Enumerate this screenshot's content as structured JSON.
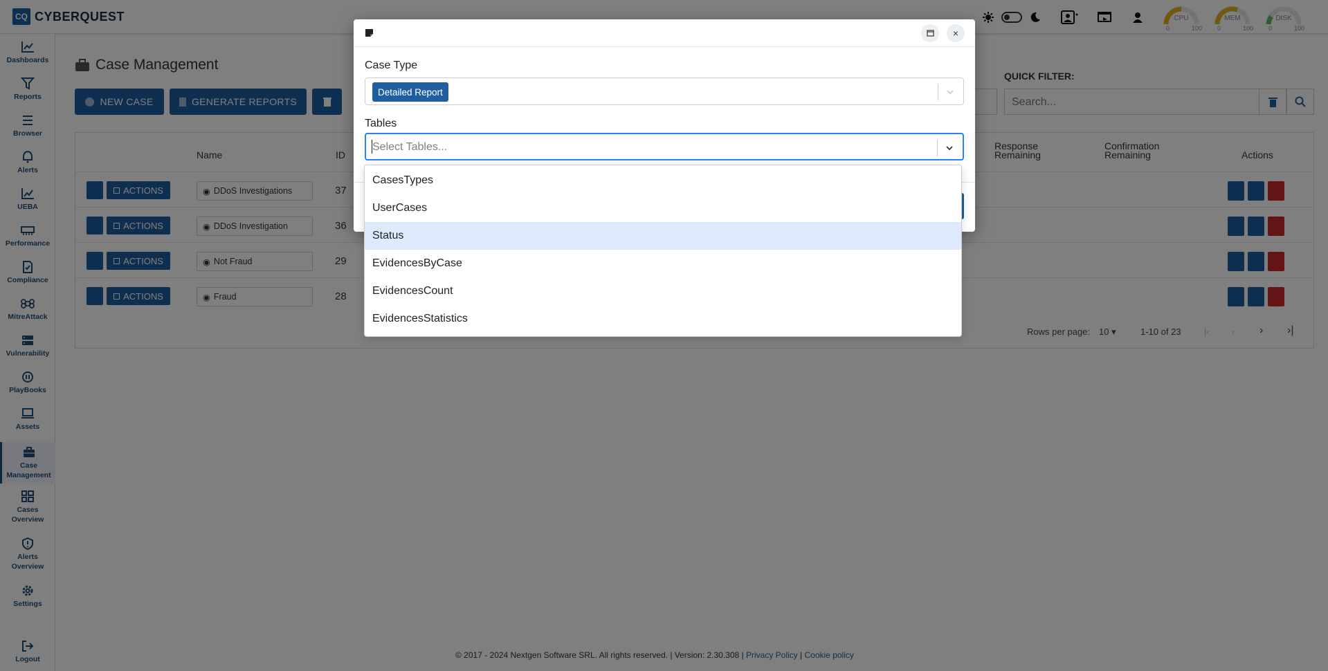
{
  "app": {
    "logo_mark": "CQ",
    "logo_text": "CYBERQUEST"
  },
  "gauges": [
    {
      "label": "CPU",
      "min": "0",
      "max": "100"
    },
    {
      "label": "MEM",
      "min": "0",
      "max": "100"
    },
    {
      "label": "DISK",
      "min": "0",
      "max": "100"
    }
  ],
  "sidebar": {
    "items": [
      {
        "label": "Dashboards",
        "icon": "chart-line-icon"
      },
      {
        "label": "Reports",
        "icon": "filter-icon"
      },
      {
        "label": "Browser",
        "icon": "list-icon"
      },
      {
        "label": "Alerts",
        "icon": "bell-icon"
      },
      {
        "label": "UEBA",
        "icon": "chart-icon"
      },
      {
        "label": "Performance",
        "icon": "memory-icon"
      },
      {
        "label": "Compliance",
        "icon": "document-check-icon"
      },
      {
        "label": "MitreAttack",
        "icon": "command-icon"
      },
      {
        "label": "Vulnerability",
        "icon": "server-icon"
      },
      {
        "label": "PlayBooks",
        "icon": "playbook-icon"
      },
      {
        "label": "Assets",
        "icon": "laptop-icon"
      },
      {
        "label": "Case",
        "label2": "Management",
        "icon": "briefcase-icon"
      },
      {
        "label": "Cases",
        "label2": "Overview",
        "icon": "grid-icon"
      },
      {
        "label": "Alerts",
        "label2": "Overview",
        "icon": "shield-alert-icon"
      },
      {
        "label": "Settings",
        "icon": "gear-icon"
      },
      {
        "label": "Logout",
        "icon": "logout-icon"
      }
    ]
  },
  "page": {
    "title": "Case Management",
    "new_case_label": "NEW CASE",
    "generate_reports_label": "GENERATE REPORTS",
    "quick_filter_label": "QUICK FILTER:",
    "quick_filter_placeholder": "Search..."
  },
  "table": {
    "columns": {
      "name": "Name",
      "id": "ID",
      "response_1": "Response",
      "response_2": "Remaining",
      "confirmation_1": "Confirmation",
      "confirmation_2": "Remaining",
      "actions": "Actions"
    },
    "action_label": "ACTIONS",
    "rows": [
      {
        "name": "DDoS Investigations",
        "id": "37"
      },
      {
        "name": "DDoS Investigation",
        "id": "36"
      },
      {
        "name": "Not Fraud",
        "id": "29"
      },
      {
        "name": "Fraud",
        "id": "28"
      }
    ]
  },
  "pagination": {
    "rows_per_page_label": "Rows per page:",
    "rows_per_page_value": "10",
    "range": "1-10 of 23"
  },
  "footer": {
    "text": "© 2017 - 2024 Nextgen Software SRL. All rights reserved. | Version: 2.30.308 |",
    "privacy": "Privacy Policy",
    "separator": "|",
    "cookie": "Cookie policy"
  },
  "modal": {
    "case_type_label": "Case Type",
    "case_type_value": "Detailed Report",
    "tables_label": "Tables",
    "tables_placeholder": "Select Tables...",
    "close_glyph": "×",
    "options": [
      "CasesTypes",
      "UserCases",
      "Status",
      "EvidencesByCase",
      "EvidencesCount",
      "EvidencesStatistics"
    ],
    "highlighted_option": "Status"
  },
  "colors": {
    "primary": "#1f5fa0",
    "danger": "#c62828",
    "highlight": "#deebff",
    "focus": "#2684ff"
  }
}
